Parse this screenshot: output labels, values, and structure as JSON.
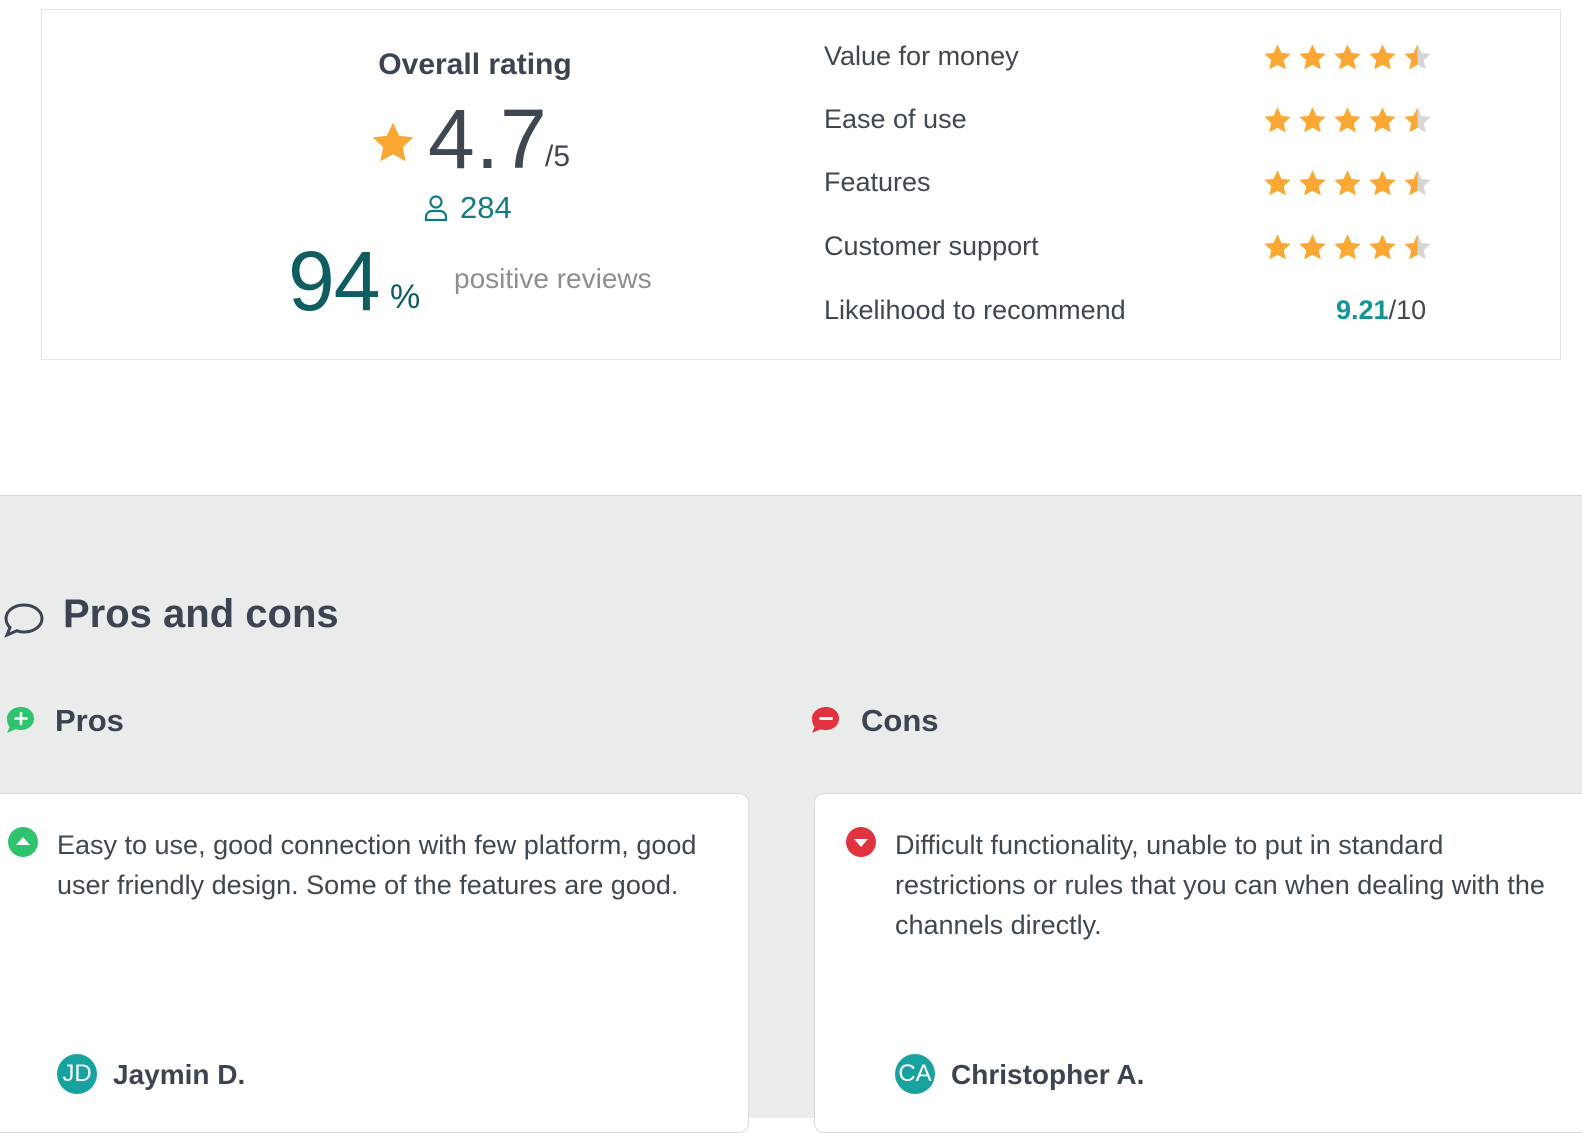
{
  "summary": {
    "overall_label": "Overall rating",
    "score": "4.7",
    "out_of": "/5",
    "review_count": "284",
    "positive_pct": "94",
    "positive_pct_sign": "%",
    "positive_label": "positive reviews",
    "star_color": "#fba733",
    "star_empty_color": "#d6d6d6",
    "criteria": [
      {
        "label": "Value for money",
        "rating": 4.5
      },
      {
        "label": "Ease of use",
        "rating": 4.5
      },
      {
        "label": "Features",
        "rating": 4.5
      },
      {
        "label": "Customer support",
        "rating": 4.5
      }
    ],
    "recommend": {
      "label": "Likelihood to recommend",
      "value": "9.21",
      "suffix": "/10"
    }
  },
  "pros_cons": {
    "title": "Pros and cons",
    "pros": {
      "label": "Pros",
      "accent": "#2ec46e",
      "text": "Easy to use, good connection with few platform, good user friendly design. Some of the features are good.",
      "author_initials": "JD",
      "author_name": "Jaymin D."
    },
    "cons": {
      "label": "Cons",
      "accent": "#e0323f",
      "text": "Difficult functionality, unable to put in standard restrictions or rules that you can when dealing with the channels directly.",
      "author_initials": "CA",
      "author_name": "Christopher A."
    }
  }
}
